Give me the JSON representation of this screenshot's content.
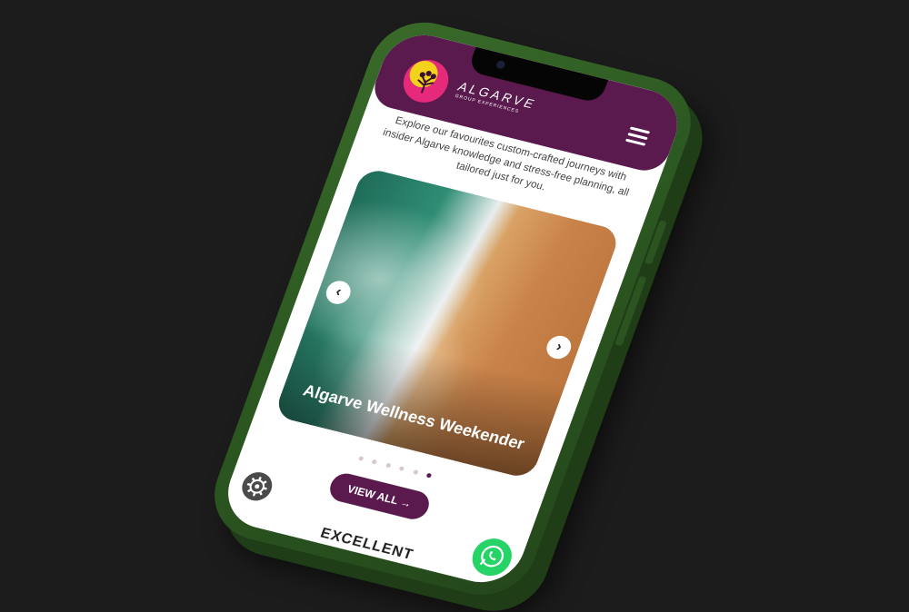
{
  "brand": {
    "name": "ALGARVE",
    "tagline": "GROUP EXPERIENCES"
  },
  "intro": {
    "text": "Explore our favourites custom-crafted journeys with insider Algarve knowledge and stress-free planning, all tailored just for you."
  },
  "carousel": {
    "slide_title": "Algarve Wellness Weekender",
    "prev_icon": "‹",
    "next_icon": "›",
    "dots_count": 6,
    "active_dot": 5
  },
  "cta": {
    "view_all_label": "VIEW ALL →"
  },
  "reviews": {
    "heading": "EXCELLENT"
  },
  "colors": {
    "brand_purple": "#5a1a4e",
    "whatsapp_green": "#25d366",
    "phone_green": "#2d5a22"
  },
  "icons": {
    "menu": "hamburger-icon",
    "settings": "gear-icon",
    "chat": "whatsapp-icon"
  }
}
